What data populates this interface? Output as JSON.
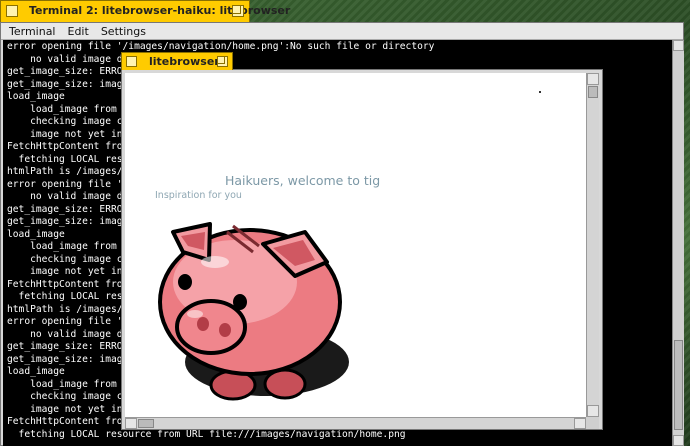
{
  "terminal": {
    "title": "Terminal 2: litebrowser-haiku: litebrowser",
    "menu": [
      "Terminal",
      "Edit",
      "Settings"
    ],
    "lines": [
      "error opening file '/images/navigation/home.png':No such file or directory",
      "    no valid image dat",
      "get_image_size: ERROR",
      "get_image_size: image",
      "load_image",
      "    load_image from abs",
      "    checking image cach",
      "    image not yet in ca",
      "FetchHttpContent from",
      "  fetching LOCAL resou",
      "htmlPath is /images/na",
      "error opening file '/i",
      "    no valid image dat",
      "get_image_size: ERROR",
      "get_image_size: image",
      "load_image",
      "    load_image from abs",
      "    checking image cach",
      "    image not yet in ca",
      "FetchHttpContent from",
      "  fetching LOCAL resou",
      "htmlPath is /images/Pe",
      "error opening file '/i",
      "    no valid image dat",
      "get_image_size: ERROR",
      "get_image_size: image",
      "load_image",
      "    load_image from abs",
      "    checking image cach",
      "    image not yet in ca",
      "FetchHttpContent from",
      "  fetching LOCAL resource from URL file:///images/navigation/home.png"
    ]
  },
  "browser": {
    "title": "litebrowser",
    "page": {
      "heading": "Haikuers, welcome to tig",
      "tagline": "Inspiration for you",
      "image_icon": "piggy-bank-icon"
    }
  },
  "colors": {
    "tab_yellow": "#ffcb00",
    "terminal_bg": "#000000",
    "terminal_fg": "#ffffff",
    "heading_color": "#7c98a6",
    "pig_pink": "#e8737a"
  }
}
